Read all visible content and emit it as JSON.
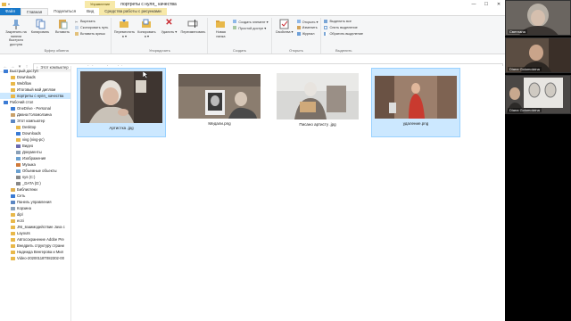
{
  "window": {
    "title": "портреты с нуля_ качества",
    "context_tab": "Управление",
    "controls": [
      "—",
      "☐",
      "✕"
    ]
  },
  "tabs": [
    {
      "label": "Файл"
    },
    {
      "label": "Главная"
    },
    {
      "label": "Поделиться"
    },
    {
      "label": "Вид"
    },
    {
      "label": "Средства работы с рисунками"
    }
  ],
  "ribbon": {
    "clipboard": {
      "label": "Буфер обмена",
      "pin": "Закрепить на панели быстрого доступа",
      "copy": "Копировать",
      "paste": "Вставить",
      "cut": "Вырезать",
      "copy_path": "Скопировать путь",
      "paste_shortcut": "Вставить ярлык"
    },
    "organize": {
      "label": "Упорядочить",
      "move": "Переместить в ▾",
      "copyto": "Копировать в ▾",
      "delete": "Удалить ▾",
      "rename": "Переименовать"
    },
    "create": {
      "label": "Создать",
      "new_folder": "Новая папка",
      "new_item": "Создать элемент ▾",
      "easy_access": "Простой доступ ▾"
    },
    "open": {
      "label": "Открыть",
      "properties": "Свойства ▾",
      "open": "Открыть ▾",
      "edit": "Изменить",
      "history": "Журнал"
    },
    "select": {
      "label": "Выделить",
      "select_all": "Выделить все",
      "select_none": "Снять выделение",
      "invert": "Обратить выделение"
    }
  },
  "address": {
    "crumbs": [
      "Этот компьютер",
      "_DATA (D:)",
      "Earth_Evolution",
      "Искусство",
      "портреты с нуля_ качества"
    ]
  },
  "nav": [
    {
      "label": "Быстрый доступ",
      "icon": "star-icon",
      "level": 0
    },
    {
      "label": "Downloads",
      "icon": "folder-icon",
      "level": 1
    },
    {
      "label": "Webflow",
      "icon": "folder-icon",
      "level": 1
    },
    {
      "label": "Итоговый мой диплом",
      "icon": "folder-icon",
      "level": 1
    },
    {
      "label": "портреты с нуля_ качества",
      "icon": "folder-icon",
      "level": 1,
      "selected": true
    },
    {
      "label": "Рабочий стол",
      "icon": "desktop-icon",
      "level": 0
    },
    {
      "label": "OneDrive - Personal",
      "icon": "cloud-icon",
      "level": 1
    },
    {
      "label": "Диана Голомолзина",
      "icon": "user-icon",
      "level": 1
    },
    {
      "label": "Этот компьютер",
      "icon": "computer-icon",
      "level": 1
    },
    {
      "label": "Desktop",
      "icon": "folder-icon",
      "level": 2
    },
    {
      "label": "Downloads",
      "icon": "download-icon",
      "level": 2
    },
    {
      "label": "vivg (vivg-pc)",
      "icon": "folder-icon",
      "level": 2
    },
    {
      "label": "Видео",
      "icon": "video-icon",
      "level": 2
    },
    {
      "label": "Документы",
      "icon": "docs-icon",
      "level": 2
    },
    {
      "label": "Изображения",
      "icon": "images-icon",
      "level": 2
    },
    {
      "label": "Музыка",
      "icon": "music-icon",
      "level": 2
    },
    {
      "label": "Объемные объекты",
      "icon": "cube-icon",
      "level": 2
    },
    {
      "label": "sys (C:)",
      "icon": "drive-icon",
      "level": 2
    },
    {
      "label": "_DATA (D:)",
      "icon": "drive-icon",
      "level": 2
    },
    {
      "label": "Библиотеки",
      "icon": "library-icon",
      "level": 1
    },
    {
      "label": "Сеть",
      "icon": "network-icon",
      "level": 1
    },
    {
      "label": "Панель управления",
      "icon": "control-panel-icon",
      "level": 1
    },
    {
      "label": "Корзина",
      "icon": "trash-icon",
      "level": 1
    },
    {
      "label": "dipl",
      "icon": "folder-icon",
      "level": 1
    },
    {
      "label": "ec4i",
      "icon": "folder-icon",
      "level": 1
    },
    {
      "label": "JNI_взаимодействие Java с",
      "icon": "folder-icon",
      "level": 1
    },
    {
      "label": "Layouts",
      "icon": "folder-icon",
      "level": 1
    },
    {
      "label": "Автосохранение Adobe Pre",
      "icon": "folder-icon",
      "level": 1
    },
    {
      "label": "Внедрить структуру страни",
      "icon": "folder-icon",
      "level": 1
    },
    {
      "label": "Надежда Венгерова и Мил",
      "icon": "folder-icon",
      "level": 1
    },
    {
      "label": "Video-20200118T082302-00",
      "icon": "folder-icon",
      "level": 1
    }
  ],
  "files": [
    {
      "name": "Артистка .jpg",
      "selected": true
    },
    {
      "name": "Медали.png",
      "selected": false
    },
    {
      "name": "Писано артисту .jpg",
      "selected": false
    },
    {
      "name": "удаление.png",
      "selected": true
    }
  ],
  "participants": [
    {
      "name": "Светлана"
    },
    {
      "name": "Diana Golomolzina"
    },
    {
      "name": "Diana Golomolzina"
    }
  ]
}
